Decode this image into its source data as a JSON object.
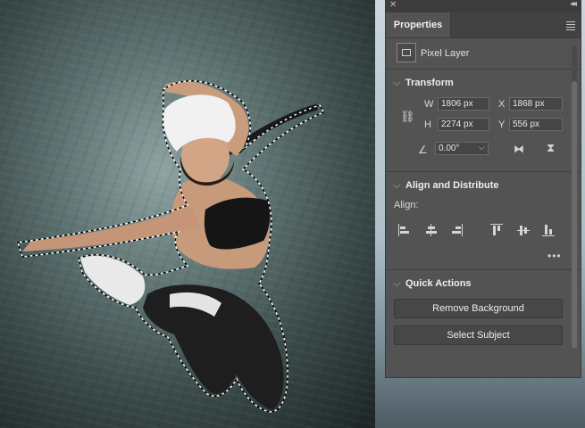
{
  "panel": {
    "tab_label": "Properties",
    "layer_type": "Pixel Layer"
  },
  "transform": {
    "heading": "Transform",
    "w_label": "W",
    "w_value": "1806 px",
    "x_label": "X",
    "x_value": "1868 px",
    "h_label": "H",
    "h_value": "2274 px",
    "y_label": "Y",
    "y_value": "556 px",
    "angle_value": "0.00°"
  },
  "align": {
    "heading": "Align and Distribute",
    "label": "Align:"
  },
  "quick_actions": {
    "heading": "Quick Actions",
    "remove_bg_label": "Remove Background",
    "select_subject_label": "Select Subject"
  },
  "icons": [
    "close-icon",
    "collapse-icon",
    "panel-menu-icon",
    "pixel-layer-icon",
    "link-icon",
    "angle-icon",
    "flip-horizontal-icon",
    "flip-vertical-icon",
    "more-icon",
    "chevron-down-icon"
  ]
}
